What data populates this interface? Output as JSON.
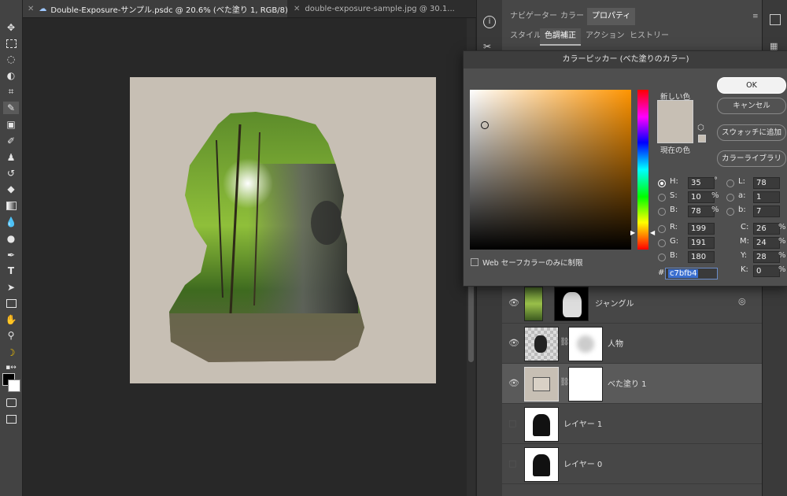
{
  "tabs": [
    {
      "label": "Double-Exposure-サンプル.psdc @ 20.6% (べた塗り 1, RGB/8) *"
    },
    {
      "label": "double-exposure-sample.jpg @ 30.1..."
    }
  ],
  "panel_tabs": [
    "ナビゲーター",
    "カラー",
    "プロパティ"
  ],
  "panel_tabs2": [
    "スタイル",
    "色調補正",
    "アクション",
    "ヒストリー"
  ],
  "picker": {
    "title": "カラーピッカー (べた塗りのカラー)",
    "new_label": "新しい色",
    "current_label": "現在の色",
    "buttons": [
      "OK",
      "キャンセル",
      "スウォッチに追加",
      "カラーライブラリ"
    ],
    "web_safe_label": "Web セーフカラーのみに制限",
    "new_color": "#c7bfb4",
    "current_color": "#c7bfb4",
    "hex_label": "#",
    "hex": "c7bfb4",
    "fields": {
      "H": {
        "label": "H:",
        "value": "35",
        "unit": "°"
      },
      "S": {
        "label": "S:",
        "value": "10",
        "unit": "%"
      },
      "B": {
        "label": "B:",
        "value": "78",
        "unit": "%"
      },
      "R": {
        "label": "R:",
        "value": "199"
      },
      "G": {
        "label": "G:",
        "value": "191"
      },
      "Bl": {
        "label": "B:",
        "value": "180"
      },
      "L": {
        "label": "L:",
        "value": "78"
      },
      "a": {
        "label": "a:",
        "value": "1"
      },
      "b": {
        "label": "b:",
        "value": "7"
      },
      "C": {
        "label": "C:",
        "value": "26",
        "unit": "%"
      },
      "M": {
        "label": "M:",
        "value": "24",
        "unit": "%"
      },
      "Y": {
        "label": "Y:",
        "value": "28",
        "unit": "%"
      },
      "K": {
        "label": "K:",
        "value": "0",
        "unit": "%"
      }
    }
  },
  "layers": [
    {
      "name": "ジャングル"
    },
    {
      "name": "人物"
    },
    {
      "name": "べた塗り 1"
    },
    {
      "name": "レイヤー 1"
    },
    {
      "name": "レイヤー 0"
    }
  ],
  "document": {
    "background": "#c7bfb4"
  }
}
